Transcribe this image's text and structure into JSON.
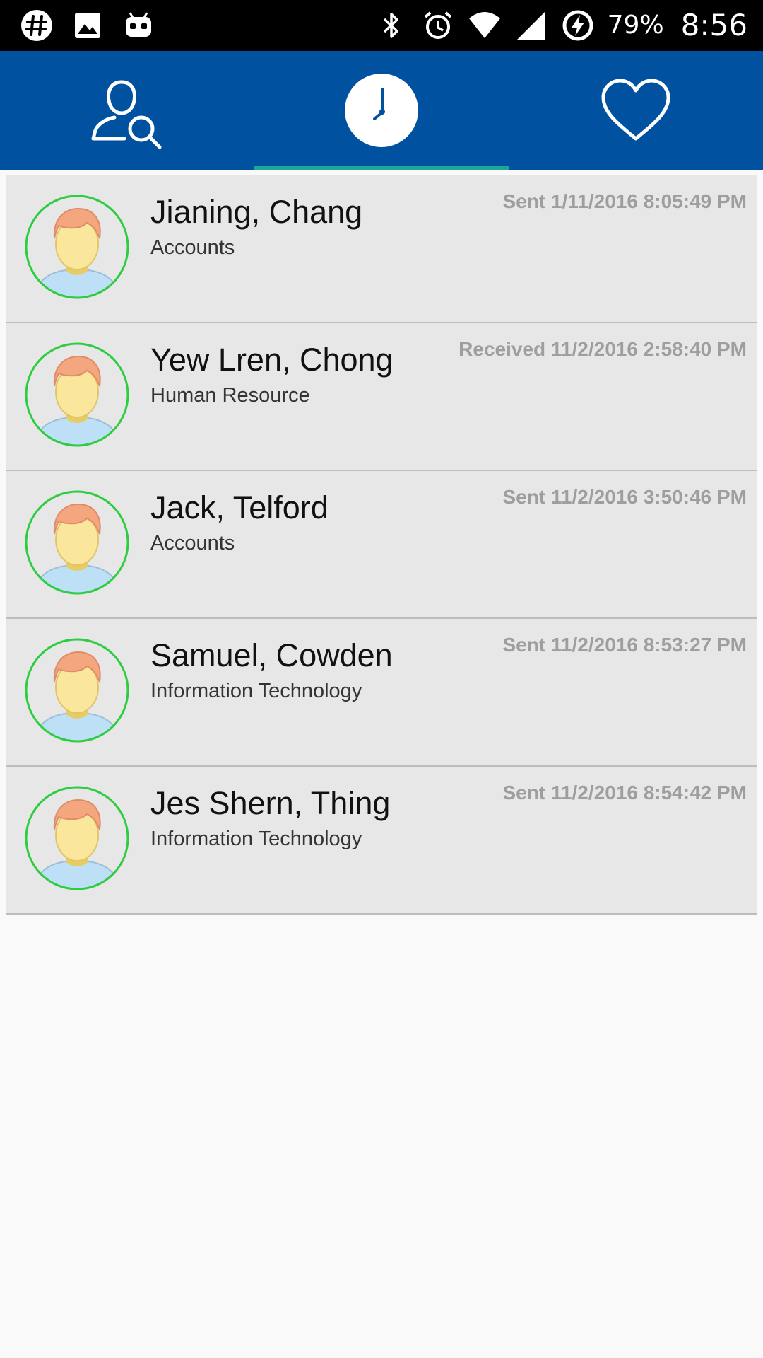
{
  "status_bar": {
    "left_icons": [
      "hashtag-icon",
      "image-icon",
      "android-icon"
    ],
    "right_icons": [
      "bluetooth-icon",
      "alarm-icon",
      "wifi-icon",
      "signal-icon",
      "battery-charging-icon"
    ],
    "battery": "79%",
    "time": "8:56"
  },
  "tabs": [
    {
      "icon": "contact-search-icon",
      "active": false
    },
    {
      "icon": "clock-icon",
      "active": true
    },
    {
      "icon": "heart-icon",
      "active": false
    }
  ],
  "colors": {
    "tab_bar": "#0051a0",
    "tab_indicator": "#1aa89a",
    "avatar_ring": "#2ecc40",
    "row_background": "#e7e7e7",
    "timestamp": "#9e9e9e"
  },
  "contacts": [
    {
      "name": "Jianing, Chang",
      "department": "Accounts",
      "timestamp": "Sent 1/11/2016 8:05:49 PM"
    },
    {
      "name": "Yew Lren, Chong",
      "department": "Human Resource",
      "timestamp": "Received 11/2/2016 2:58:40 PM"
    },
    {
      "name": "Jack, Telford",
      "department": "Accounts",
      "timestamp": "Sent 11/2/2016 3:50:46 PM"
    },
    {
      "name": "Samuel, Cowden",
      "department": "Information Technology",
      "timestamp": "Sent 11/2/2016 8:53:27 PM"
    },
    {
      "name": "Jes Shern, Thing",
      "department": "Information Technology",
      "timestamp": "Sent 11/2/2016 8:54:42 PM"
    }
  ]
}
